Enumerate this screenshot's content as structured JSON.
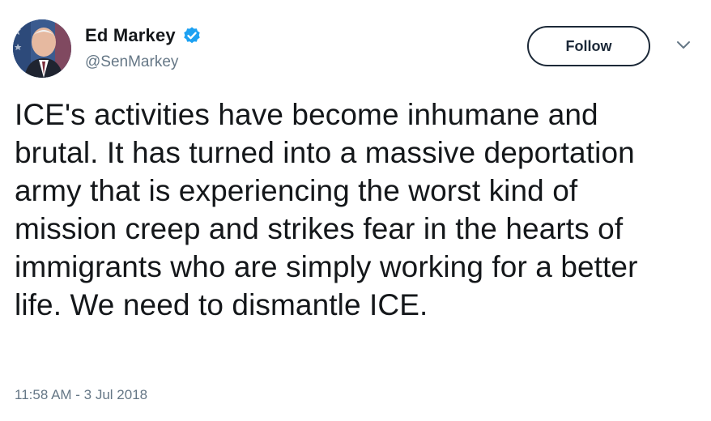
{
  "user": {
    "display_name": "Ed Markey",
    "handle": "@SenMarkey",
    "verified": true
  },
  "actions": {
    "follow_label": "Follow"
  },
  "tweet": {
    "text": "ICE's activities have become inhumane and brutal. It has turned into a massive deportation army that is experiencing the worst kind of mission creep and strikes fear in the hearts of immigrants who are simply working for a better life. We need to dismantle ICE.",
    "timestamp": "11:58 AM - 3 Jul 2018"
  },
  "icons": {
    "verified": "verified-badge-icon",
    "more": "chevron-down-icon"
  },
  "colors": {
    "verified_blue": "#1da1f2",
    "text": "#14171a",
    "secondary_text": "#657786",
    "button_border": "#1c2938"
  }
}
